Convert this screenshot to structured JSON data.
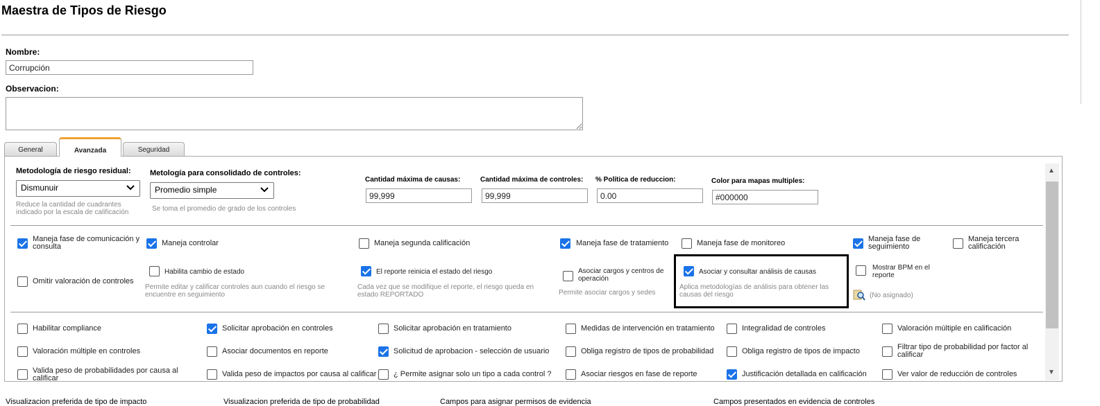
{
  "page": {
    "title": "Maestra de Tipos de Riesgo"
  },
  "form": {
    "nombre_label": "Nombre:",
    "nombre_value": "Corrupción",
    "observacion_label": "Observacion:"
  },
  "tabs": [
    {
      "label": "General",
      "active": false
    },
    {
      "label": "Avanzada",
      "active": true
    },
    {
      "label": "Seguridad",
      "active": false
    }
  ],
  "advanced": {
    "metodologia_label": "Metodología de riesgo residual:",
    "metodologia_value": "Dismunuir",
    "metodologia_hint": "Reduce la cantidad de cuadrantes indicado por la escala de calificación",
    "consolidado_label": "Metología para consolidado de controles:",
    "consolidado_value": "Promedio simple",
    "consolidado_hint": "Se toma el promedio de grado de los controles",
    "max_causas_label": "Cantidad máxima de causas:",
    "max_causas_value": "99,999",
    "max_controles_label": "Cantidad máxima de controles:",
    "max_controles_value": "99,999",
    "politica_label": "% Política de reduccion:",
    "politica_value": "0.00",
    "color_label": "Color para mapas multiples:",
    "color_value": "#000000"
  },
  "checks_a": [
    {
      "label": "Maneja fase de comunicación y consulta",
      "checked": true
    },
    {
      "label": "Maneja controlar",
      "checked": true
    },
    {
      "label": "Maneja segunda calificación",
      "checked": false
    },
    {
      "label": "Maneja fase de tratamiento",
      "checked": true
    },
    {
      "label": "Maneja fase de monitoreo",
      "checked": false
    },
    {
      "label": "Maneja fase de seguimiento",
      "checked": true
    },
    {
      "label": "Maneja tercera calificación",
      "checked": false
    },
    {
      "label": "Omitir valoración de controles",
      "checked": false
    },
    {
      "label": "Habilita cambio de estado",
      "checked": false
    },
    {
      "label": "El reporte reinicia el estado del riesgo",
      "checked": true
    },
    {
      "label": "Asociar cargos y centros de operación",
      "checked": false
    },
    {
      "label": "Asociar y consultar análisis de causas",
      "checked": true
    },
    {
      "label": "Mostrar BPM en el reporte",
      "checked": false
    }
  ],
  "hints_a": {
    "cambio_estado": "Permite editar y calificar controles aun cuando el riesgo se encuentre en seguimiento",
    "reinicia": "Cada vez que se modifique el reporte, el riesgo queda en estado REPORTADO",
    "cargos": "Permite asociar cargos y sedes",
    "causas": "Aplica metodologías de análisis para obtener las causas del riesgo",
    "bpm": "(No asignado)"
  },
  "checks_b": [
    {
      "label": "Habilitar compliance",
      "checked": false
    },
    {
      "label": "Solicitar aprobación en controles",
      "checked": true
    },
    {
      "label": "Solicitar aprobación en tratamiento",
      "checked": false
    },
    {
      "label": "Medidas de intervención en tratamiento",
      "checked": false
    },
    {
      "label": "Integralidad de controles",
      "checked": false
    },
    {
      "label": "Valoración múltiple en calificación",
      "checked": false
    },
    {
      "label": "Valoración múltiple en controles",
      "checked": false
    },
    {
      "label": "Asociar documentos en reporte",
      "checked": false
    },
    {
      "label": "Solicitud de aprobacion - selección de usuario",
      "checked": true
    },
    {
      "label": "Obliga registro de tipos de probabilidad",
      "checked": false
    },
    {
      "label": "Obliga registro de tipos de impacto",
      "checked": false
    },
    {
      "label": "Filtrar tipo de probabilidad por factor al calificar",
      "checked": false
    },
    {
      "label": "Valida peso de probabilidades por causa al calificar",
      "checked": false
    },
    {
      "label": "Valida peso de impactos por causa al calificar",
      "checked": false
    },
    {
      "label": "¿ Permite asignar solo un tipo a cada control ?",
      "checked": false
    },
    {
      "label": "Asociar riesgos en fase de reporte",
      "checked": false
    },
    {
      "label": "Justificación detallada en calificación",
      "checked": true
    },
    {
      "label": "Ver valor de reducción de controles",
      "checked": false
    }
  ],
  "bottom": [
    "Visualizacion preferida de tipo de impacto",
    "Visualizacion preferida de tipo de probabilidad",
    "Campos para asignar permisos de evidencia",
    "Campos presentados en evidencia de controles"
  ],
  "colors": {
    "accent_tab": "#f0a030",
    "checkbox_on": "#1a73e8"
  },
  "icons": [
    "chevron-down-icon",
    "magnifier-icon",
    "scroll-up-icon",
    "scroll-down-icon",
    "resize-grip-icon"
  ]
}
